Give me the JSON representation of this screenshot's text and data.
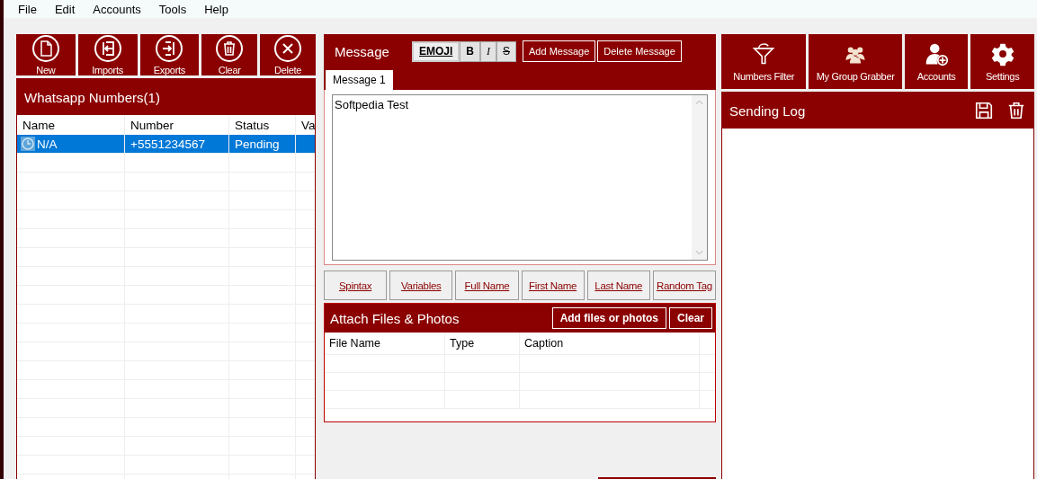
{
  "menu": [
    "File",
    "Edit",
    "Accounts",
    "Tools",
    "Help"
  ],
  "left_toolbar": [
    {
      "label": "New"
    },
    {
      "label": "Imports"
    },
    {
      "label": "Exports"
    },
    {
      "label": "Clear"
    },
    {
      "label": "Delete"
    }
  ],
  "numbers": {
    "title": "Whatsapp Numbers(1)",
    "columns": [
      "Name",
      "Number",
      "Status",
      "Va"
    ],
    "rows": [
      {
        "cells": [
          "N/A",
          "+5551234567",
          "Pending",
          ""
        ],
        "selected": true
      }
    ]
  },
  "message": {
    "title": "Message",
    "format_buttons": [
      {
        "label": "EMOJI",
        "kind": "emoji"
      },
      {
        "label": "B",
        "kind": "bold"
      },
      {
        "label": "I",
        "kind": "italic"
      },
      {
        "label": "S",
        "kind": "strike"
      }
    ],
    "actions": [
      "Add Message",
      "Delete Message"
    ],
    "tabs": [
      {
        "label": "Message 1",
        "selected": true
      }
    ],
    "value": "Softpedia Test",
    "insert_links": [
      "Spintax",
      "Variables",
      "Full Name",
      "First Name",
      "Last Name",
      "Random Tag"
    ]
  },
  "attach": {
    "title": "Attach Files & Photos",
    "buttons": [
      "Add files or photos",
      "Clear"
    ],
    "columns": [
      "File Name",
      "Type",
      "Caption"
    ]
  },
  "right_toolbar": [
    {
      "label": "Numbers Filter"
    },
    {
      "label": "My Group Grabber"
    },
    {
      "label": "Accounts"
    },
    {
      "label": "Settings"
    }
  ],
  "log": {
    "title": "Sending Log"
  }
}
